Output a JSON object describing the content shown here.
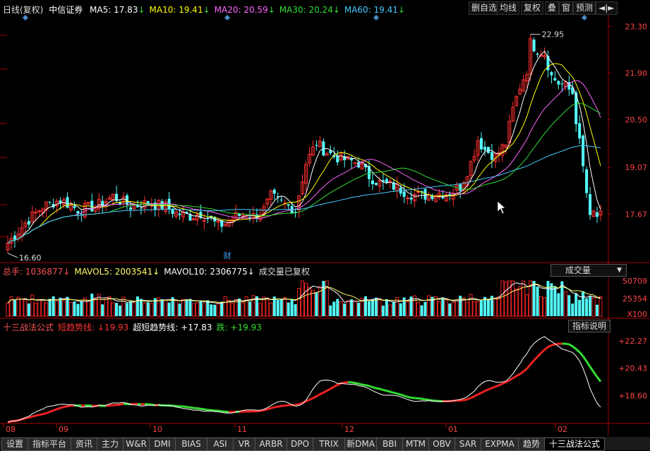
{
  "header": {
    "period": "日线(复权)",
    "stock": "中信证券",
    "ma": [
      {
        "label": "MA5: 17.83",
        "arrow": "↓",
        "color": "#ffffff"
      },
      {
        "label": "MA10: 19.41",
        "arrow": "↓",
        "color": "#ffff00"
      },
      {
        "label": "MA20: 20.59",
        "arrow": "↓",
        "color": "#ff66ff"
      },
      {
        "label": "MA30: 20.24",
        "arrow": "↓",
        "color": "#33dd33"
      },
      {
        "label": "MA60: 19.41",
        "arrow": "↓",
        "color": "#44ccff"
      }
    ]
  },
  "toolbar": [
    "删自选",
    "均线",
    "复权",
    "叠",
    "窗",
    "预测",
    "◄|►"
  ],
  "price_axis": [
    "23.30",
    "21.90",
    "20.50",
    "19.07",
    "17.67"
  ],
  "annotations": {
    "high": "22.95",
    "low": "16.60",
    "event_marker": "财"
  },
  "volume": {
    "header": [
      {
        "text": "总手: 1036877↓",
        "color": "#ff5555"
      },
      {
        "text": "MAVOL5: 2003541↓",
        "color": "#ffff66"
      },
      {
        "text": "MAVOL10: 2306775↓",
        "color": "#ffffff"
      },
      {
        "text": "成交量已复权",
        "color": "#dddddd"
      }
    ],
    "dropdown": "成交量",
    "axis": [
      "50709",
      "25354",
      "X100"
    ],
    "series_colors": {
      "up": "#ee2222",
      "down": "#54ffff"
    }
  },
  "indicator": {
    "header": [
      {
        "text": "十三战法公式",
        "color": "#ff5555"
      },
      {
        "text": "短趋势线: ↓19.93",
        "color": "#ff3333"
      },
      {
        "text": "超短趋势线: +17.83",
        "color": "#ffffff"
      },
      {
        "text": "跌: +19.93",
        "color": "#33dd33"
      }
    ],
    "button": "指标说明",
    "axis": [
      "+22.27",
      "+20.43",
      "+18.60"
    ]
  },
  "x_axis": [
    "08",
    "09",
    "10",
    "11",
    "12",
    "01",
    "02"
  ],
  "tabs": [
    "设置",
    "指标平台",
    "资讯",
    "主力",
    "W&R",
    "DMI",
    "BIAS",
    "ASI",
    "VR",
    "ARBR",
    "DPO",
    "TRIX",
    "新DMA",
    "BBI",
    "MTM",
    "OBV",
    "SAR",
    "EXPMA",
    "趋势",
    "十三战法公式"
  ],
  "active_tab": "十三战法公式",
  "chart_data": {
    "type": "candlestick",
    "y_axis_ticks": [
      23.3,
      21.9,
      20.5,
      19.07,
      17.67
    ],
    "anchors": [
      [
        0,
        16.8
      ],
      [
        5,
        17.4
      ],
      [
        10,
        17.9
      ],
      [
        15,
        18.1
      ],
      [
        20,
        17.8
      ],
      [
        25,
        17.9
      ],
      [
        30,
        18.2
      ],
      [
        35,
        17.9
      ],
      [
        40,
        18.0
      ],
      [
        45,
        17.9
      ],
      [
        48,
        17.7
      ],
      [
        52,
        17.6
      ],
      [
        55,
        17.7
      ],
      [
        58,
        17.5
      ],
      [
        60,
        17.3
      ],
      [
        62,
        17.4
      ],
      [
        65,
        17.6
      ],
      [
        68,
        17.7
      ],
      [
        70,
        17.6
      ],
      [
        73,
        17.8
      ],
      [
        75,
        18.2
      ],
      [
        78,
        18.0
      ],
      [
        82,
        17.8
      ],
      [
        85,
        19.2
      ],
      [
        88,
        19.8
      ],
      [
        90,
        19.6
      ],
      [
        93,
        19.4
      ],
      [
        96,
        19.3
      ],
      [
        100,
        19.2
      ],
      [
        103,
        18.8
      ],
      [
        106,
        18.6
      ],
      [
        110,
        18.5
      ],
      [
        114,
        18.3
      ],
      [
        118,
        18.2
      ],
      [
        122,
        18.3
      ],
      [
        126,
        18.3
      ],
      [
        129,
        18.5
      ],
      [
        132,
        19.2
      ],
      [
        134,
        19.9
      ],
      [
        136,
        19.6
      ],
      [
        139,
        19.4
      ],
      [
        142,
        19.8
      ],
      [
        144,
        20.8
      ],
      [
        146,
        21.5
      ],
      [
        148,
        22.0
      ],
      [
        149,
        22.8
      ],
      [
        151,
        22.6
      ],
      [
        153,
        22.5
      ],
      [
        155,
        21.8
      ],
      [
        157,
        21.6
      ],
      [
        159,
        21.5
      ],
      [
        161,
        21.3
      ],
      [
        162,
        20.5
      ],
      [
        163,
        19.8
      ],
      [
        165,
        18.3
      ],
      [
        166,
        17.5
      ],
      [
        167,
        17.7
      ],
      [
        168,
        17.6
      ]
    ],
    "volume_scale": [
      0,
      50709
    ],
    "indicator_range": [
      17.0,
      22.6
    ]
  }
}
